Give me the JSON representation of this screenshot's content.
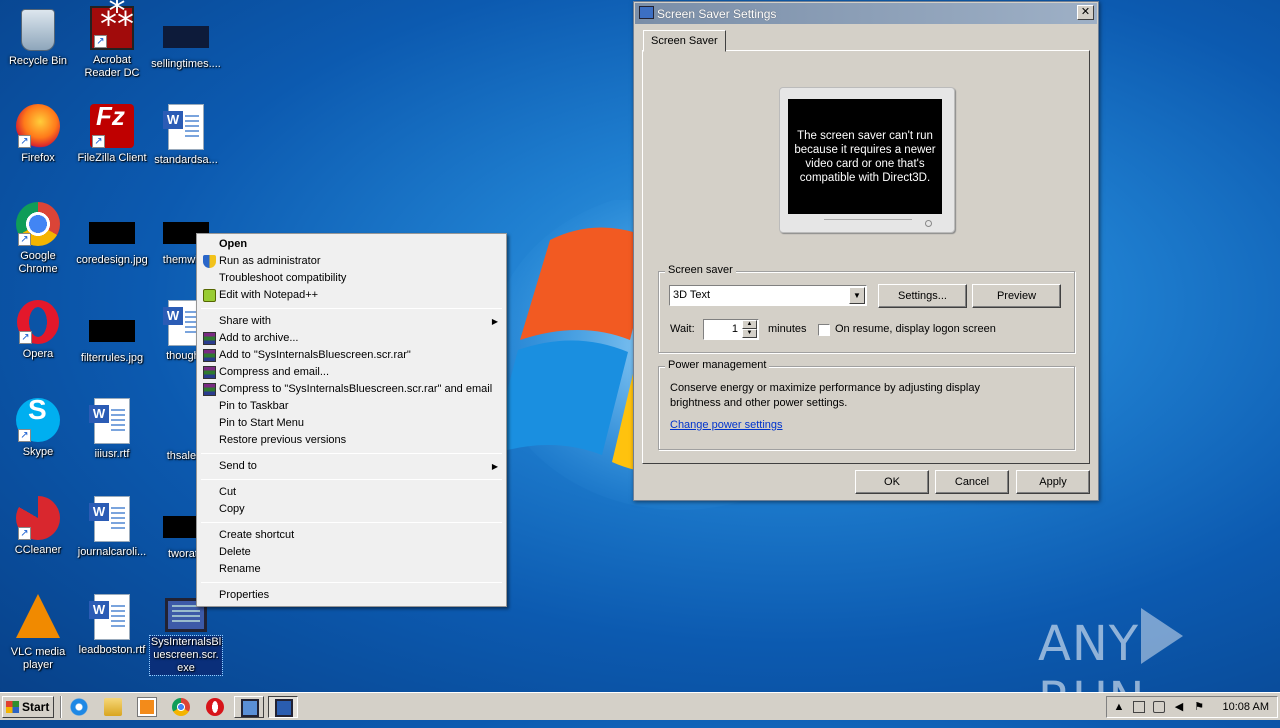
{
  "desktop": {
    "icons": [
      {
        "label": "Recycle Bin"
      },
      {
        "label": "Acrobat\nReader DC"
      },
      {
        "label": "sellingtimes...."
      },
      {
        "label": "Firefox"
      },
      {
        "label": "FileZilla Client"
      },
      {
        "label": "standardsa..."
      },
      {
        "label": "Google\nChrome"
      },
      {
        "label": "coredesign.jpg"
      },
      {
        "label": "themwhic"
      },
      {
        "label": "Opera"
      },
      {
        "label": "filterrules.jpg"
      },
      {
        "label": "thoughtf"
      },
      {
        "label": "Skype"
      },
      {
        "label": "iiiusr.rtf"
      },
      {
        "label": "thsale.p"
      },
      {
        "label": "CCleaner"
      },
      {
        "label": "journalcaroli..."
      },
      {
        "label": "tworate"
      },
      {
        "label": "VLC media\nplayer"
      },
      {
        "label": "leadboston.rtf"
      },
      {
        "label": "SysInternalsBl\nuescreen.scr.\nexe"
      }
    ],
    "watermark_left": "ANY",
    "watermark_right": "RUN"
  },
  "context_menu": {
    "items": [
      {
        "label": "Open"
      },
      {
        "label": "Run as administrator",
        "icon": "uac-shield-icon"
      },
      {
        "label": "Troubleshoot compatibility"
      },
      {
        "label": "Edit with Notepad++",
        "icon": "notepadpp-icon"
      },
      {
        "label": "Share with"
      },
      {
        "label": "Add to archive...",
        "icon": "winrar-icon"
      },
      {
        "label": "Add to \"SysInternalsBluescreen.scr.rar\"",
        "icon": "winrar-icon"
      },
      {
        "label": "Compress and email...",
        "icon": "winrar-icon"
      },
      {
        "label": "Compress to \"SysInternalsBluescreen.scr.rar\" and email",
        "icon": "winrar-icon"
      },
      {
        "label": "Pin to Taskbar"
      },
      {
        "label": "Pin to Start Menu"
      },
      {
        "label": "Restore previous versions"
      },
      {
        "label": "Send to"
      },
      {
        "label": "Cut"
      },
      {
        "label": "Copy"
      },
      {
        "label": "Create shortcut"
      },
      {
        "label": "Delete"
      },
      {
        "label": "Rename"
      },
      {
        "label": "Properties"
      }
    ]
  },
  "dialog": {
    "title": "Screen Saver Settings",
    "close_label": "✕",
    "tab": "Screen Saver",
    "preview_message": "The screen saver can't run because it requires a newer video card or one that's compatible with Direct3D.",
    "screensaver_group": "Screen saver",
    "screensaver_selected": "3D Text",
    "settings_button": "Settings...",
    "preview_button": "Preview",
    "wait_label": "Wait:",
    "wait_value": "1",
    "minutes_label": "minutes",
    "resume_label": "On resume, display logon screen",
    "resume_checked": false,
    "power_group": "Power management",
    "power_text": "Conserve energy or maximize performance by adjusting display brightness and other power settings.",
    "power_link": "Change power settings",
    "ok": "OK",
    "cancel": "Cancel",
    "apply": "Apply"
  },
  "taskbar": {
    "start": "Start",
    "clock": "10:08 AM",
    "pinned_icons": [
      "ie-icon",
      "explorer-icon",
      "media-player-icon",
      "chrome-icon",
      "opera-icon"
    ],
    "tasks": [
      "display-control-panel-icon",
      "screensaver-icon"
    ]
  }
}
